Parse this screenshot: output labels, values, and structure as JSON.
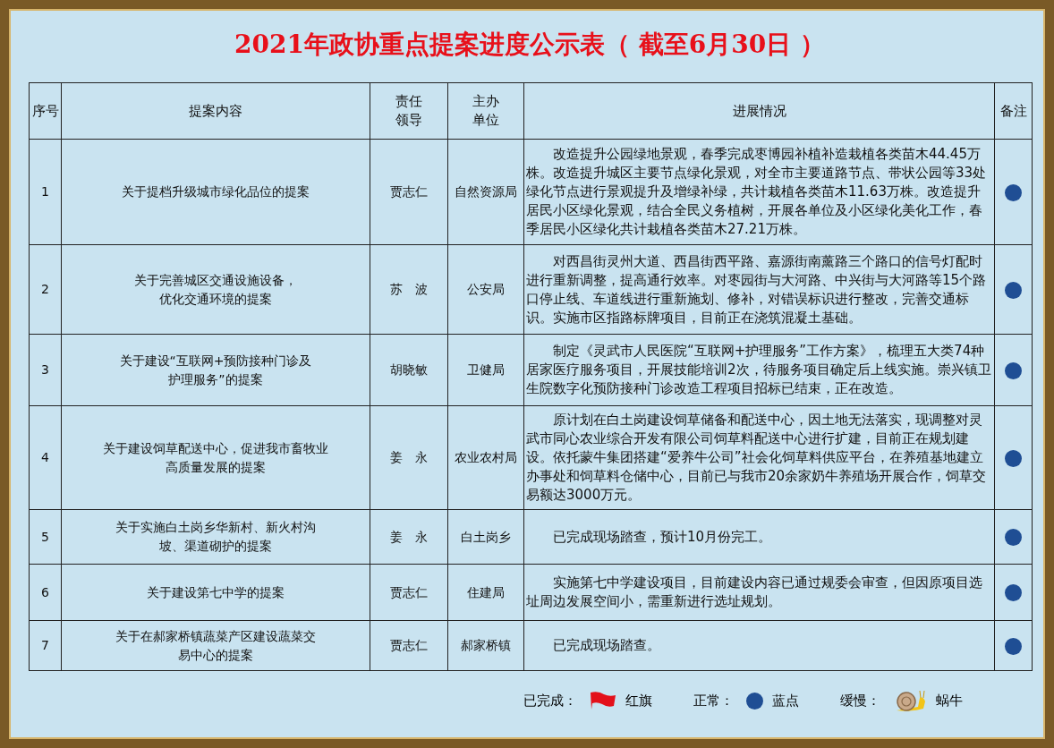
{
  "title": "2021年政协重点提案进度公示表（ 截至6月30日 ）",
  "table": {
    "columns": [
      "序号",
      "提案内容",
      "责任领导",
      "主办单位",
      "进展情况",
      "备注"
    ],
    "rows": [
      {
        "no": "1",
        "proposal": "关于提档升级城市绿化品位的提案",
        "leader": "贾志仁",
        "unit": "自然资源局",
        "progress": "改造提升公园绿地景观，春季完成枣博园补植补造栽植各类苗木44.45万株。改造提升城区主要节点绿化景观，对全市主要道路节点、带状公园等33处绿化节点进行景观提升及增绿补绿，共计栽植各类苗木11.63万株。改造提升居民小区绿化景观，结合全民义务植树，开展各单位及小区绿化美化工作，春季居民小区绿化共计栽植各类苗木27.21万株。",
        "kind": "normal"
      },
      {
        "no": "2",
        "proposal": "关于完善城区交通设施设备，优化交通环境的提案",
        "leader": "苏　波",
        "unit": "公安局",
        "progress": "对西昌街灵州大道、西昌街西平路、嘉源街南薰路三个路口的信号灯配时进行重新调整，提高通行效率。对枣园街与大河路、中兴街与大河路等15个路口停止线、车道线进行重新施划、修补，对错误标识进行整改，完善交通标识。实施市区指路标牌项目，目前正在浇筑混凝土基础。",
        "kind": "normal"
      },
      {
        "no": "3",
        "proposal": "关于建设“互联网+预防接种门诊及护理服务”的提案",
        "leader": "胡晓敏",
        "unit": "卫健局",
        "progress": "制定《灵武市人民医院“互联网+护理服务”工作方案》，梳理五大类74种居家医疗服务项目，开展技能培训2次，待服务项目确定后上线实施。崇兴镇卫生院数字化预防接种门诊改造工程项目招标已结束，正在改造。",
        "kind": "normal"
      },
      {
        "no": "4",
        "proposal": "关于建设饲草配送中心，促进我市畜牧业高质量发展的提案",
        "leader": "姜　永",
        "unit": "农业农村局",
        "progress": "原计划在白土岗建设饲草储备和配送中心，因土地无法落实，现调整对灵武市同心农业综合开发有限公司饲草料配送中心进行扩建，目前正在规划建设。依托蒙牛集团搭建“爱养牛公司”社会化饲草料供应平台，在养殖基地建立办事处和饲草料仓储中心，目前已与我市20余家奶牛养殖场开展合作，饲草交易额达3000万元。",
        "kind": "normal"
      },
      {
        "no": "5",
        "proposal": "关于实施白土岗乡华新村、新火村沟坡、渠道砌护的提案",
        "leader": "姜　永",
        "unit": "白土岗乡",
        "progress": "已完成现场踏查，预计10月份完工。",
        "kind": "normal"
      },
      {
        "no": "6",
        "proposal": "关于建设第七中学的提案",
        "leader": "贾志仁",
        "unit": "住建局",
        "progress": "实施第七中学建设项目，目前建设内容已通过规委会审查，但因原项目选址周边发展空间小，需重新进行选址规划。",
        "kind": "normal"
      },
      {
        "no": "7",
        "proposal": "关于在郝家桥镇蔬菜产区建设蔬菜交易中心的提案",
        "leader": "贾志仁",
        "unit": "郝家桥镇",
        "progress": "已完成现场踏查。",
        "kind": "normal"
      }
    ]
  },
  "legend": [
    {
      "label": "已完成：",
      "kind": "done",
      "meaning": "红旗"
    },
    {
      "label": "正常：",
      "kind": "normal",
      "meaning": "蓝点"
    },
    {
      "label": "缓慢：",
      "kind": "slow",
      "meaning": "蜗牛"
    }
  ]
}
